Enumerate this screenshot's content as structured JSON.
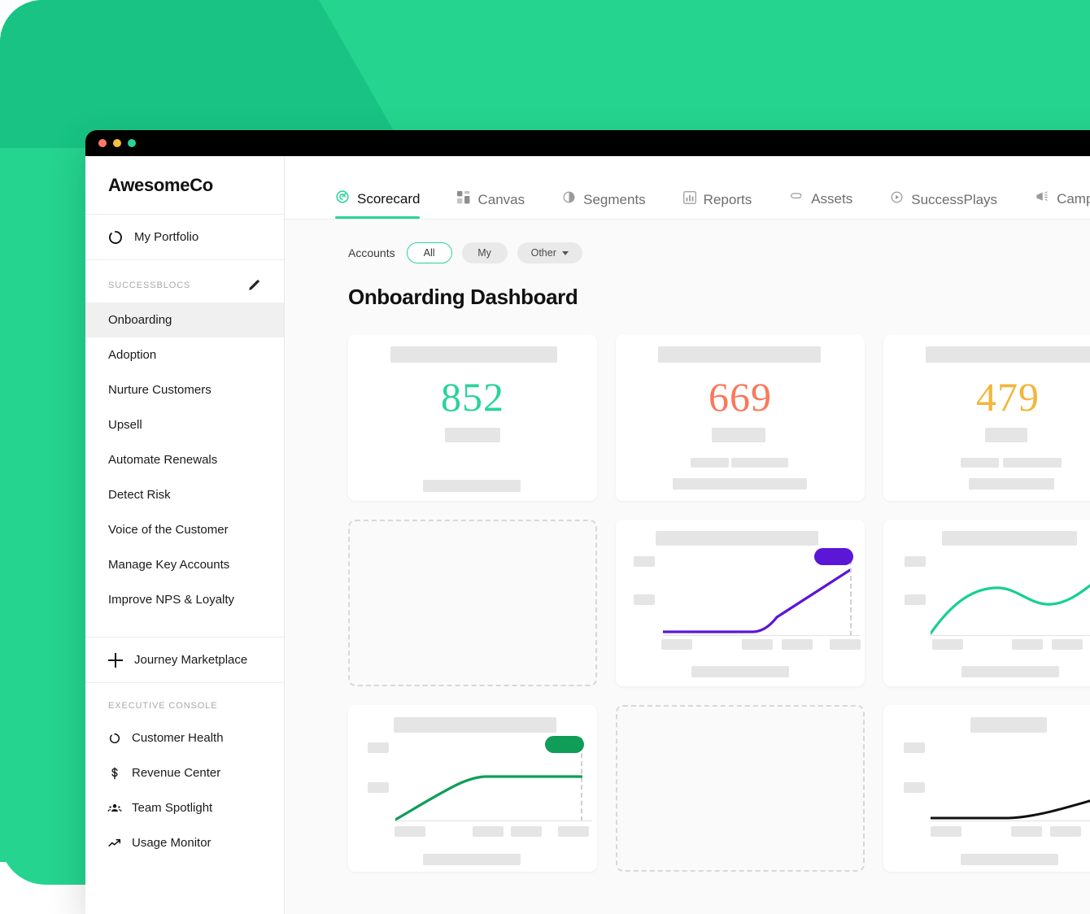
{
  "window": {
    "traffic_lights": [
      "close",
      "minimize",
      "maximize"
    ]
  },
  "sidebar": {
    "brand": "AwesomeCo",
    "portfolio": {
      "label": "My Portfolio",
      "icon": "portfolio-ring-icon"
    },
    "successblocs": {
      "section_title": "SUCCESSBLOCS",
      "edit_icon": "pencil-icon",
      "items": [
        {
          "label": "Onboarding",
          "active": true
        },
        {
          "label": "Adoption",
          "active": false
        },
        {
          "label": "Nurture Customers",
          "active": false
        },
        {
          "label": "Upsell",
          "active": false
        },
        {
          "label": "Automate Renewals",
          "active": false
        },
        {
          "label": "Detect Risk",
          "active": false
        },
        {
          "label": "Voice of the Customer",
          "active": false
        },
        {
          "label": "Manage Key Accounts",
          "active": false
        },
        {
          "label": "Improve NPS & Loyalty",
          "active": false
        }
      ]
    },
    "marketplace": {
      "label": "Journey Marketplace",
      "icon": "plus-icon"
    },
    "executive_console": {
      "section_title": "EXECUTIVE CONSOLE",
      "items": [
        {
          "label": "Customer Health",
          "icon": "ring-icon"
        },
        {
          "label": "Revenue Center",
          "icon": "dollar-icon"
        },
        {
          "label": "Team Spotlight",
          "icon": "people-icon"
        },
        {
          "label": "Usage Monitor",
          "icon": "trending-up-icon"
        }
      ]
    }
  },
  "tabs": [
    {
      "label": "Scorecard",
      "icon": "target-icon",
      "active": true
    },
    {
      "label": "Canvas",
      "icon": "grid-blocks-icon",
      "active": false
    },
    {
      "label": "Segments",
      "icon": "pie-half-icon",
      "active": false
    },
    {
      "label": "Reports",
      "icon": "bar-chart-icon",
      "active": false
    },
    {
      "label": "Assets",
      "icon": "paperclip-icon",
      "active": false
    },
    {
      "label": "SuccessPlays",
      "icon": "play-circle-icon",
      "active": false
    },
    {
      "label": "Campaigns",
      "icon": "megaphone-icon",
      "active": false
    }
  ],
  "toolbar": {
    "accounts_label": "Accounts",
    "filters": [
      {
        "label": "All",
        "selected": true,
        "has_caret": false
      },
      {
        "label": "My",
        "selected": false,
        "has_caret": false
      },
      {
        "label": "Other",
        "selected": false,
        "has_caret": true
      }
    ]
  },
  "main": {
    "page_title": "Onboarding Dashboard"
  },
  "colors": {
    "brand_green": "#2ad39a",
    "bg_green": "#25d48f",
    "bg_green_dark": "#18c383",
    "kpi_green": "#2ad39a",
    "kpi_orange": "#f9795b",
    "kpi_yellow": "#f2b63c",
    "line_purple": "#5b16d6",
    "line_mint": "#16cf94",
    "line_green": "#0f9d58",
    "line_black": "#111111",
    "skeleton": "#e5e5e5",
    "dashed_border": "#d8d8d8"
  },
  "chart_data": [
    {
      "id": "kpi-1",
      "type": "kpi",
      "value": "852",
      "color": "#2ad39a",
      "title": "",
      "subtitle": ""
    },
    {
      "id": "kpi-2",
      "type": "kpi",
      "value": "669",
      "color": "#f9795b",
      "title": "",
      "subtitle": ""
    },
    {
      "id": "kpi-3",
      "type": "kpi",
      "value": "479",
      "color": "#f2b63c",
      "title": "",
      "subtitle": ""
    },
    {
      "id": "chart-purple",
      "type": "line",
      "title": "",
      "xlabel": "",
      "ylabel": "",
      "grid": false,
      "legend": "none",
      "color": "#5b16d6",
      "x": [
        0,
        1,
        2,
        3,
        4,
        5,
        6,
        7,
        8,
        9,
        10
      ],
      "values": [
        2,
        2,
        2,
        2,
        2,
        2,
        4,
        14,
        30,
        48,
        68
      ],
      "ylim": [
        0,
        100
      ],
      "annotations": [
        "target-dashed-line-at-x-max",
        "purple-end-badge"
      ]
    },
    {
      "id": "chart-mint",
      "type": "line",
      "title": "",
      "xlabel": "",
      "ylabel": "",
      "grid": false,
      "legend": "none",
      "color": "#16cf94",
      "x": [
        0,
        1,
        2,
        3,
        4,
        5,
        6,
        7,
        8,
        9,
        10
      ],
      "values": [
        2,
        22,
        38,
        48,
        50,
        44,
        38,
        38,
        46,
        60,
        76
      ],
      "ylim": [
        0,
        100
      ],
      "annotations": [
        "mint-end-badge"
      ]
    },
    {
      "id": "chart-green",
      "type": "line",
      "title": "",
      "xlabel": "",
      "ylabel": "",
      "grid": false,
      "legend": "none",
      "color": "#0f9d58",
      "x": [
        0,
        1,
        2,
        3,
        4,
        5,
        6,
        7,
        8,
        9,
        10
      ],
      "values": [
        2,
        14,
        26,
        38,
        46,
        50,
        50,
        50,
        50,
        50,
        50
      ],
      "ylim": [
        0,
        100
      ],
      "annotations": [
        "target-dashed-line-at-x-max",
        "green-end-badge"
      ]
    },
    {
      "id": "chart-black",
      "type": "line",
      "title": "",
      "xlabel": "",
      "ylabel": "",
      "grid": false,
      "legend": "none",
      "color": "#111111",
      "x": [
        0,
        1,
        2,
        3,
        4,
        5,
        6,
        7,
        8,
        9,
        10
      ],
      "values": [
        3,
        3,
        3,
        3,
        3,
        4,
        7,
        12,
        18,
        25,
        33
      ],
      "ylim": [
        0,
        100
      ],
      "annotations": [
        "black-end-badge"
      ]
    },
    {
      "id": "ghost-1",
      "type": "placeholder",
      "title": ""
    },
    {
      "id": "ghost-2",
      "type": "placeholder",
      "title": ""
    }
  ]
}
